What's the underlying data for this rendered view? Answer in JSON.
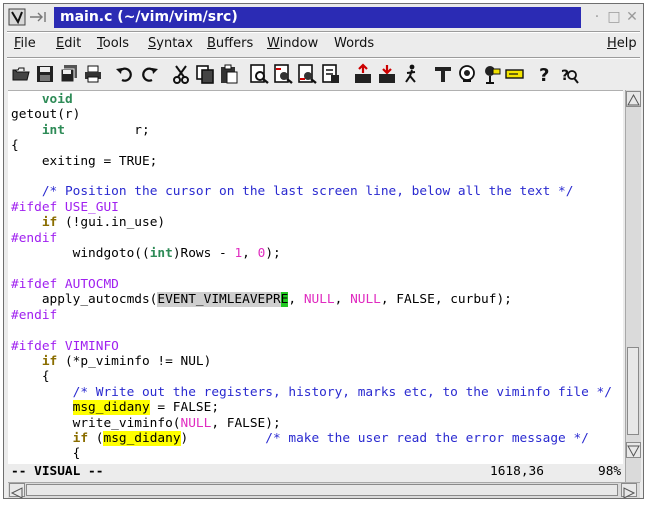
{
  "window": {
    "title": "main.c (~/vim/vim/src)"
  },
  "menus": [
    {
      "pre": "",
      "ul": "F",
      "post": "ile"
    },
    {
      "pre": "",
      "ul": "E",
      "post": "dit"
    },
    {
      "pre": "",
      "ul": "T",
      "post": "ools"
    },
    {
      "pre": "",
      "ul": "S",
      "post": "yntax"
    },
    {
      "pre": "",
      "ul": "B",
      "post": "uffers"
    },
    {
      "pre": "",
      "ul": "W",
      "post": "indow"
    },
    {
      "pre": "Words",
      "ul": "",
      "post": ""
    },
    {
      "pre": "",
      "ul": "H",
      "post": "elp"
    }
  ],
  "toolbar": {
    "icons": [
      "open-icon",
      "save-icon",
      "save-all-icon",
      "print-icon",
      "undo-icon",
      "redo-icon",
      "cut-icon",
      "copy-icon",
      "paste-icon",
      "find-icon",
      "find-next-icon",
      "find-prev-icon",
      "replace-icon",
      "load-session-icon",
      "save-session-icon",
      "run-script-icon",
      "make-icon",
      "build-tags-icon",
      "jump-tag-icon",
      "shell-icon",
      "help-icon",
      "find-help-icon"
    ]
  },
  "code": {
    "lines": [
      [
        {
          "t": "    "
        },
        {
          "t": "void",
          "c": "ty"
        }
      ],
      [
        {
          "t": "getout(r)"
        }
      ],
      [
        {
          "t": "    "
        },
        {
          "t": "int",
          "c": "ty"
        },
        {
          "t": "         r;"
        }
      ],
      [
        {
          "t": "{"
        }
      ],
      [
        {
          "t": "    exiting = TRUE;"
        }
      ],
      [
        {
          "t": ""
        }
      ],
      [
        {
          "t": "    "
        },
        {
          "t": "/* Position the cursor on the last screen line, below all the text */",
          "c": "cm"
        }
      ],
      [
        {
          "t": "#ifdef USE_GUI",
          "c": "pp"
        }
      ],
      [
        {
          "t": "    "
        },
        {
          "t": "if",
          "c": "kw"
        },
        {
          "t": " (!gui.in_use)"
        }
      ],
      [
        {
          "t": "#endif",
          "c": "pp"
        }
      ],
      [
        {
          "t": "        windgoto(("
        },
        {
          "t": "int",
          "c": "ty"
        },
        {
          "t": ")Rows - "
        },
        {
          "t": "1",
          "c": "num"
        },
        {
          "t": ", "
        },
        {
          "t": "0",
          "c": "num"
        },
        {
          "t": ");"
        }
      ],
      [
        {
          "t": ""
        }
      ],
      [
        {
          "t": "#ifdef AUTOCMD",
          "c": "pp"
        }
      ],
      [
        {
          "t": "    apply_autocmds("
        },
        {
          "t": "EVENT_VIMLEAVEPR",
          "c": "vis"
        },
        {
          "t": "E",
          "c": "cur"
        },
        {
          "t": ", "
        },
        {
          "t": "NULL",
          "c": "num"
        },
        {
          "t": ", "
        },
        {
          "t": "NULL",
          "c": "num"
        },
        {
          "t": ", FALSE, curbuf);"
        }
      ],
      [
        {
          "t": "#endif",
          "c": "pp"
        }
      ],
      [
        {
          "t": ""
        }
      ],
      [
        {
          "t": "#ifdef VIMINFO",
          "c": "pp"
        }
      ],
      [
        {
          "t": "    "
        },
        {
          "t": "if",
          "c": "kw"
        },
        {
          "t": " (*p_viminfo != NUL)"
        }
      ],
      [
        {
          "t": "    {"
        }
      ],
      [
        {
          "t": "        "
        },
        {
          "t": "/* Write out the registers, history, marks etc, to the viminfo file */",
          "c": "cm"
        }
      ],
      [
        {
          "t": "        "
        },
        {
          "t": "msg_didany",
          "c": "srch"
        },
        {
          "t": " = FALSE;"
        }
      ],
      [
        {
          "t": "        write_viminfo("
        },
        {
          "t": "NULL",
          "c": "num"
        },
        {
          "t": ", FALSE);"
        }
      ],
      [
        {
          "t": "        "
        },
        {
          "t": "if",
          "c": "kw"
        },
        {
          "t": " ("
        },
        {
          "t": "msg_didany",
          "c": "srch"
        },
        {
          "t": ")          "
        },
        {
          "t": "/* make the user read the error message */",
          "c": "cm"
        }
      ],
      [
        {
          "t": "        {"
        }
      ]
    ]
  },
  "status": {
    "mode": "-- VISUAL --",
    "position": "1618,36",
    "percent": "98%"
  }
}
